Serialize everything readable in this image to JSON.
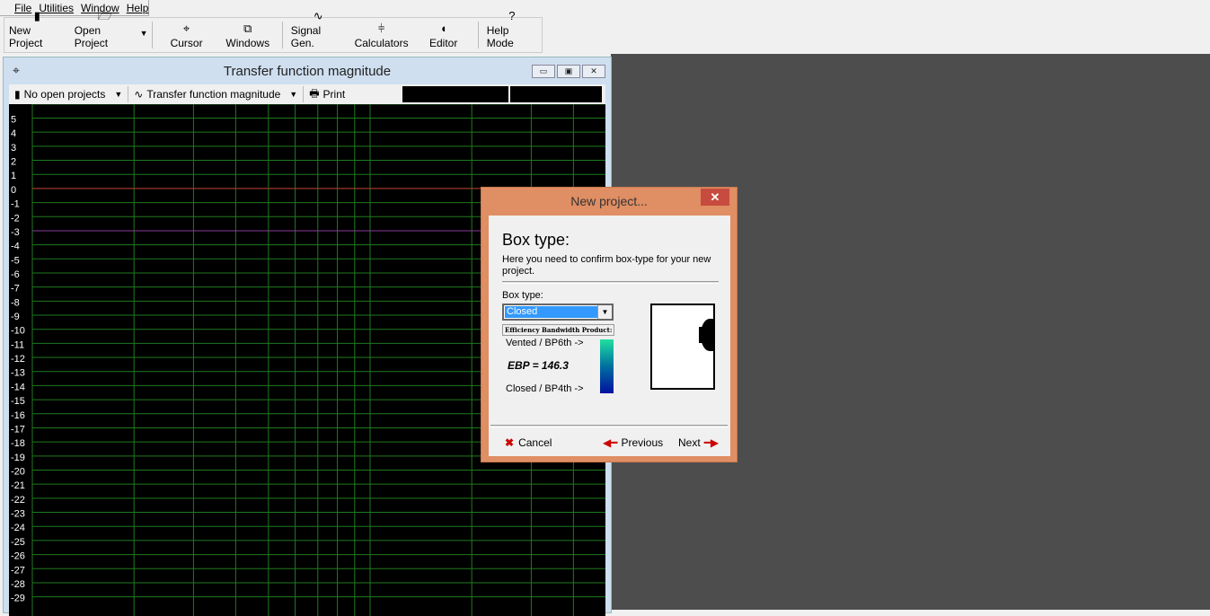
{
  "menu": [
    "File",
    "Utilities",
    "Window",
    "Help"
  ],
  "toolbar": [
    {
      "label": "New Project",
      "icon": "new-project-icon",
      "glyph": "▮"
    },
    {
      "label": "Open Project",
      "icon": "folder-icon",
      "glyph": "🗁"
    },
    {
      "label": "Cursor",
      "icon": "crosshair-icon",
      "glyph": "⌖"
    },
    {
      "label": "Windows",
      "icon": "windows-icon",
      "glyph": "⧉"
    },
    {
      "label": "Signal Gen.",
      "icon": "sine-wave-icon",
      "glyph": "∿"
    },
    {
      "label": "Calculators",
      "icon": "calculator-icon",
      "glyph": "⫩"
    },
    {
      "label": "Editor",
      "icon": "editor-icon",
      "glyph": "◖"
    },
    {
      "label": "Help Mode",
      "icon": "help-icon",
      "glyph": "?"
    }
  ],
  "window": {
    "title": "Transfer function magnitude",
    "project_select": "No open projects",
    "view_select": "Transfer function magnitude",
    "print": "Print"
  },
  "chart_data": {
    "type": "line",
    "xscale": "log",
    "grid": true,
    "ylim": [
      -29,
      5
    ],
    "yticks": [
      5,
      4,
      3,
      2,
      1,
      0,
      -1,
      -2,
      -3,
      -4,
      -5,
      -6,
      -7,
      -8,
      -9,
      -10,
      -11,
      -12,
      -13,
      -14,
      -15,
      -16,
      -17,
      -18,
      -19,
      -20,
      -21,
      -22,
      -23,
      -24,
      -25,
      -26,
      -27,
      -28,
      -29
    ],
    "reference_lines": [
      {
        "y": 0,
        "color": "#c03030"
      },
      {
        "y": -3,
        "color": "#8a3a9a"
      }
    ],
    "grid_color": "#1f7a1f"
  },
  "dialog": {
    "title": "New project...",
    "heading": "Box type:",
    "description": "Here you need to confirm box-type for your new project.",
    "box_type_label": "Box type:",
    "box_type_value": "Closed",
    "ebp_header": "Efficiency Bandwidth Product:",
    "vented_label": "Vented / BP6th ->",
    "ebp_value": "EBP = 146.3",
    "closed_label": "Closed / BP4th ->",
    "cancel": "Cancel",
    "previous": "Previous",
    "next": "Next"
  }
}
